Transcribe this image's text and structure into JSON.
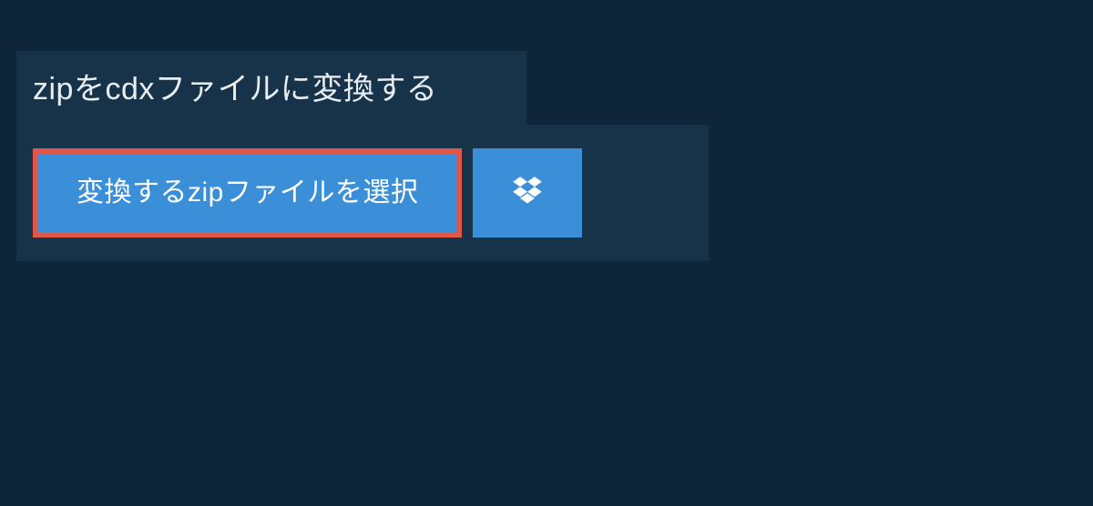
{
  "heading": "zipをcdxファイルに変換する",
  "selectButton": {
    "label": "変換するzipファイルを選択"
  },
  "colors": {
    "pageBg": "#0f2539",
    "panelBg": "#16334a",
    "buttonBg": "#3b8fd9",
    "buttonBorder": "#e0564a",
    "text": "#e8edf2"
  }
}
